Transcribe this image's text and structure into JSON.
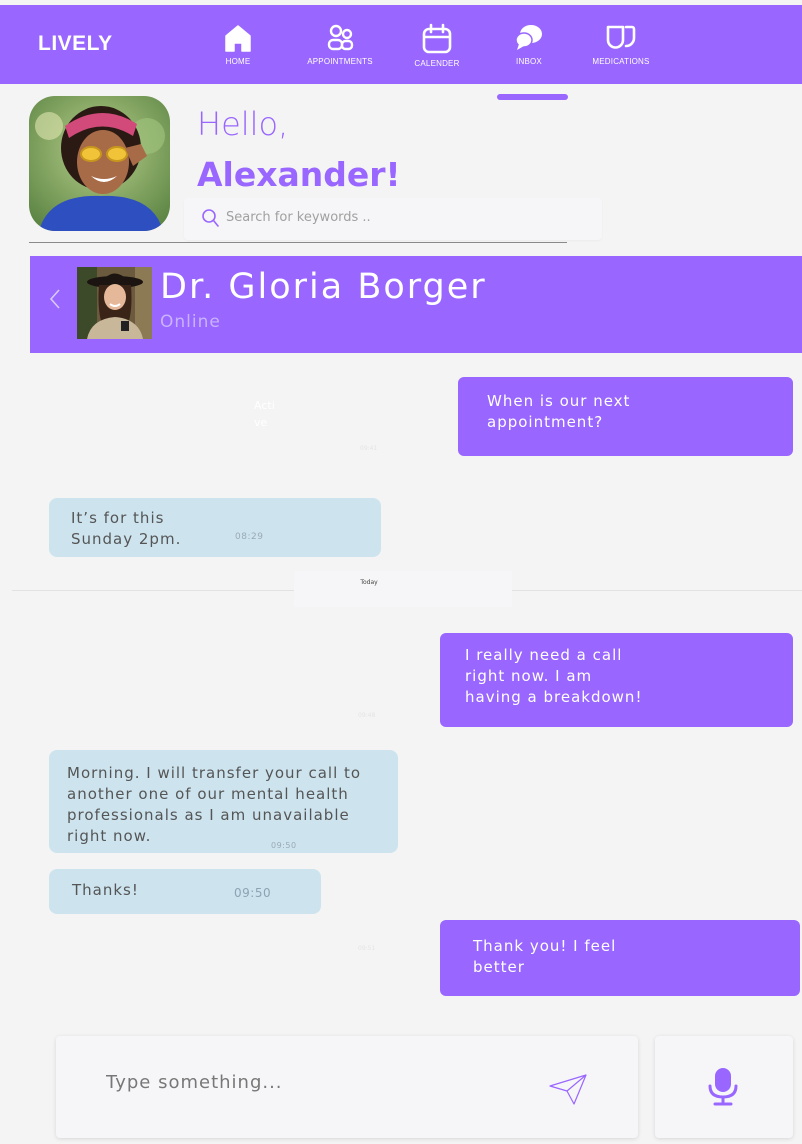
{
  "app": {
    "brand": "LIVELY"
  },
  "nav": {
    "items": [
      {
        "label": "HOME",
        "icon": "home-icon"
      },
      {
        "label": "APPOINTMENTS",
        "icon": "people-icon"
      },
      {
        "label": "CALENDER",
        "icon": "calendar-icon"
      },
      {
        "label": "INBOX",
        "icon": "chat-icon",
        "active": true
      },
      {
        "label": "MEDICATIONS",
        "icon": "pills-icon"
      }
    ]
  },
  "greeting": {
    "hello": "Hello,",
    "name": "Alexander!"
  },
  "search": {
    "placeholder": "Search for keywords ..",
    "value": ""
  },
  "chat": {
    "contact_name": "Dr. Gloria Borger",
    "contact_status": "Online",
    "ghost_label": "Active",
    "separator": "Today",
    "messages": [
      {
        "from": "me",
        "lines": [
          "When is our next",
          "appointment?"
        ],
        "time": ""
      },
      {
        "from": "doctor",
        "lines": [
          "It’s for this",
          "Sunday 2pm."
        ],
        "time": "08:29"
      },
      {
        "from": "me",
        "lines": [
          "I really need a call",
          "right now. I am",
          "having a breakdown!"
        ],
        "time": ""
      },
      {
        "from": "doctor",
        "lines": [
          "Morning. I will transfer your call to",
          "another one of our mental health",
          "professionals as I am unavailable",
          "right now."
        ],
        "time": "09:50"
      },
      {
        "from": "me_short",
        "lines": [
          "Thanks!"
        ],
        "time": "09:50"
      },
      {
        "from": "me",
        "lines": [
          "Thank you! I feel",
          "better"
        ],
        "time": ""
      }
    ]
  },
  "composer": {
    "placeholder": "Type something...",
    "value": ""
  },
  "colors": {
    "accent": "#9966ff",
    "received_bubble": "#cde4ef",
    "background": "#f4f4f4"
  }
}
